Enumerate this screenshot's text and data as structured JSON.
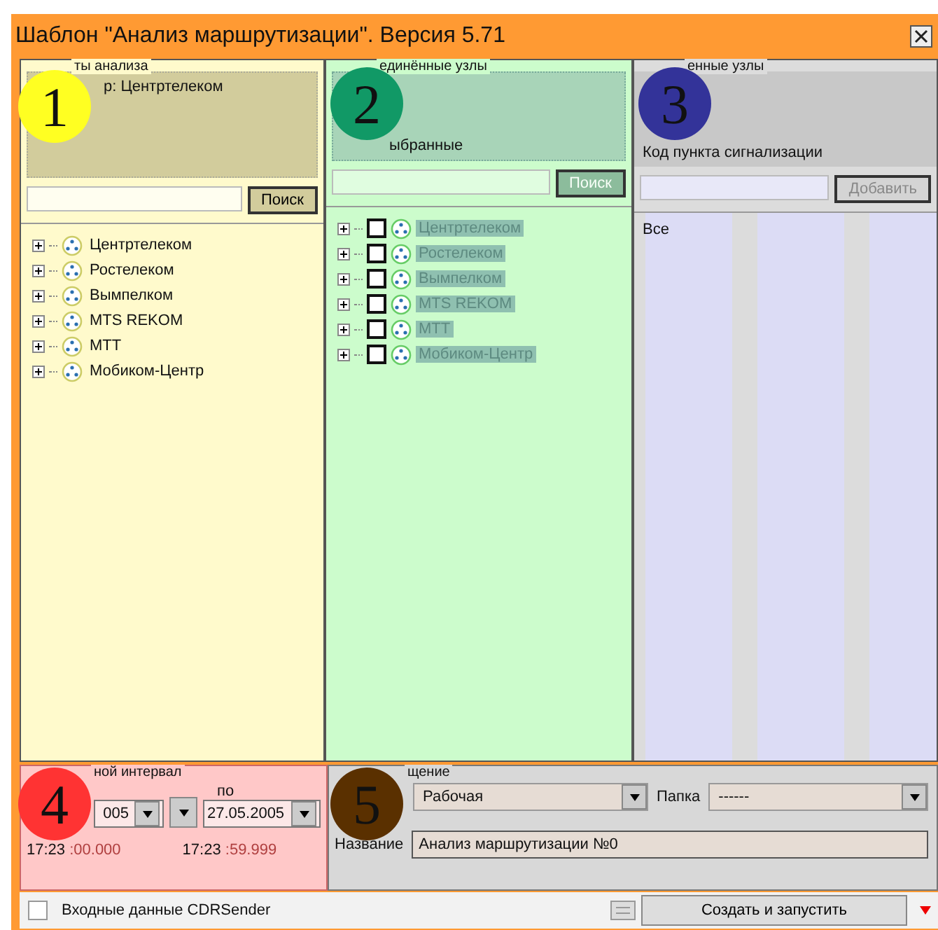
{
  "window": {
    "title": "Шаблон \"Анализ маршрутизации\". Версия 5.71"
  },
  "analysis": {
    "legend": "ты анализа",
    "filter": "р: Центртелеком",
    "search_button": "Поиск",
    "nodes": [
      {
        "label": "Центртелеком"
      },
      {
        "label": "Ростелеком"
      },
      {
        "label": "Вымпелком"
      },
      {
        "label": "MTS REKOM"
      },
      {
        "label": "МТТ"
      },
      {
        "label": "Мобиком-Центр"
      }
    ]
  },
  "linked": {
    "legend": "единённые узлы",
    "caption": "ыбранные",
    "search_button": "Поиск",
    "search_disabled": true,
    "nodes": [
      {
        "label": "Центртелеком",
        "checked": false
      },
      {
        "label": "Ростелеком",
        "checked": false
      },
      {
        "label": "Вымпелком",
        "checked": false
      },
      {
        "label": "MTS REKOM",
        "checked": false
      },
      {
        "label": "МТТ",
        "checked": false
      },
      {
        "label": "Мобиком-Центр",
        "checked": false
      }
    ]
  },
  "excluded": {
    "legend": "енные узлы",
    "code_label": "Код пункта сигнализации",
    "add_button": "Добавить",
    "add_disabled": true,
    "items": [
      "Все"
    ]
  },
  "interval": {
    "legend": "ной интервал",
    "to_label": "по",
    "from_date": "005",
    "to_date": "27.05.2005",
    "from_time": "17:23",
    "from_seconds": ":00.000",
    "to_time": "17:23",
    "to_seconds": ":59.999"
  },
  "placement": {
    "legend": "щение",
    "type_value": "Рабочая",
    "folder_label": "Папка",
    "folder_value": "------",
    "name_label": "Название",
    "name_value": "Анализ маршрутизации №0"
  },
  "footer": {
    "input_label": "Входные данные CDRSender",
    "input_checked": false,
    "run_button": "Создать и запустить"
  },
  "badges": [
    {
      "number": "1",
      "color": "#ffff22"
    },
    {
      "number": "2",
      "color": "#119966"
    },
    {
      "number": "3",
      "color": "#333399"
    },
    {
      "number": "4",
      "color": "#ff3333"
    },
    {
      "number": "5",
      "color": "#5a3000"
    }
  ]
}
